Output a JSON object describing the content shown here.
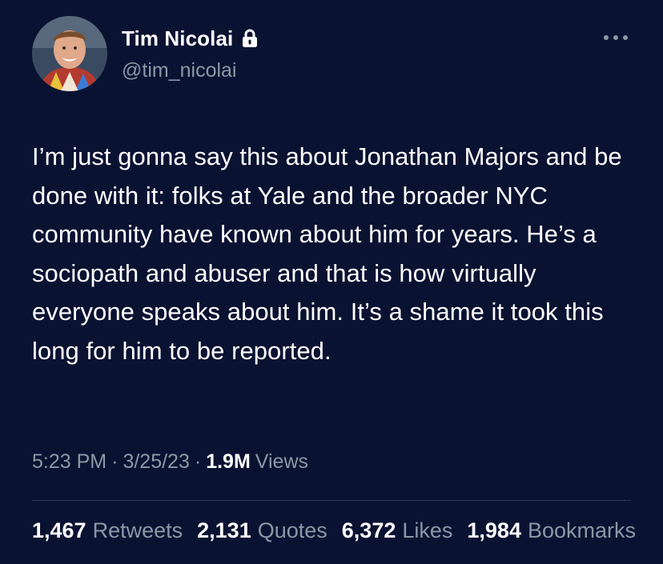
{
  "author": {
    "display_name": "Tim Nicolai",
    "handle": "@tim_nicolai",
    "protected_icon": "lock-icon",
    "avatar_icon": "avatar-photo"
  },
  "menu_icon": "more-horizontal-icon",
  "tweet": {
    "text": "I’m just gonna say this about Jonathan Majors and be done with it: folks at Yale and the broader NYC community have known about him for years. He’s a sociopath and abuser and that is how virtually everyone speaks about him. It’s a shame it took this long for him to be reported."
  },
  "meta": {
    "time": "5:23 PM",
    "separator": "·",
    "date": "3/25/23",
    "views_count": "1.9M",
    "views_label": "Views"
  },
  "stats": [
    {
      "count": "1,467",
      "label": "Retweets"
    },
    {
      "count": "2,131",
      "label": "Quotes"
    },
    {
      "count": "6,372",
      "label": "Likes"
    },
    {
      "count": "1,984",
      "label": "Bookmarks"
    }
  ],
  "colors": {
    "background": "#0a1232",
    "primary_text": "#ffffff",
    "secondary_text": "#8b98a5",
    "divider": "#2f3a4d"
  }
}
